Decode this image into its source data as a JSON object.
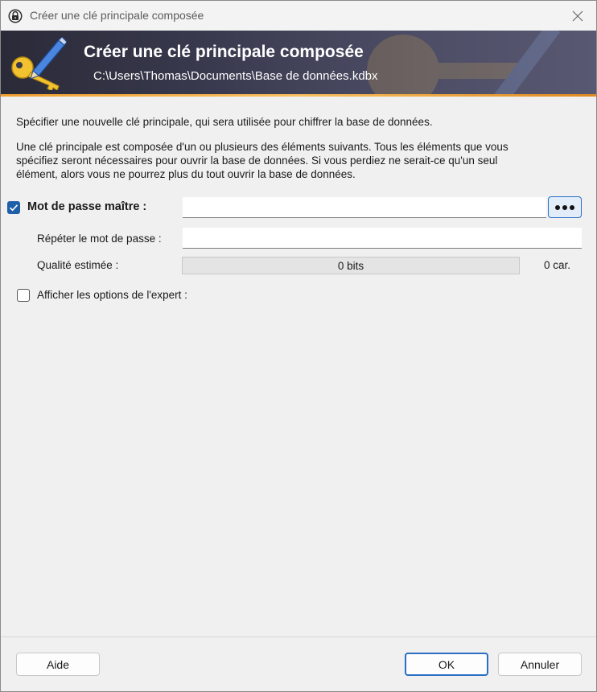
{
  "window": {
    "title": "Créer une clé principale composée",
    "title_icon": "padlock-icon",
    "close_icon": "close-icon"
  },
  "banner": {
    "title": "Créer une clé principale composée",
    "path": "C:\\Users\\Thomas\\Documents\\Base de données.kdbx",
    "icon": "key-pen-icon",
    "stripe_color": "#f0a030"
  },
  "intro": {
    "line1": "Spécifier une nouvelle clé principale, qui sera utilisée pour chiffrer la base de données.",
    "line2a": "Une clé principale est composée d'un ou plusieurs des éléments suivants. Tous les éléments que vous",
    "line2b": "spécifiez seront nécessaires pour ouvrir la base de données. Si vous perdiez ne serait-ce qu'un seul",
    "line2c": "élément, alors vous ne pourrez plus du tout ouvrir la base de données."
  },
  "master_password": {
    "checked": true,
    "label": "Mot de passe maître :",
    "value": "",
    "toggle_icon": "show-password-dots-icon",
    "repeat_label": "Répéter le mot de passe :",
    "repeat_value": "",
    "quality_label": "Qualité estimée :",
    "quality_text": "0 bits",
    "quality_fraction": 0,
    "char_count": "0 car."
  },
  "expert": {
    "checked": false,
    "label": "Afficher les options de l'expert :"
  },
  "footer": {
    "help_label": "Aide",
    "ok_label": "OK",
    "cancel_label": "Annuler"
  },
  "colors": {
    "accent": "#2a6fc4",
    "checkbox": "#1f5fa8",
    "banner_dark": "#2a2a38"
  }
}
